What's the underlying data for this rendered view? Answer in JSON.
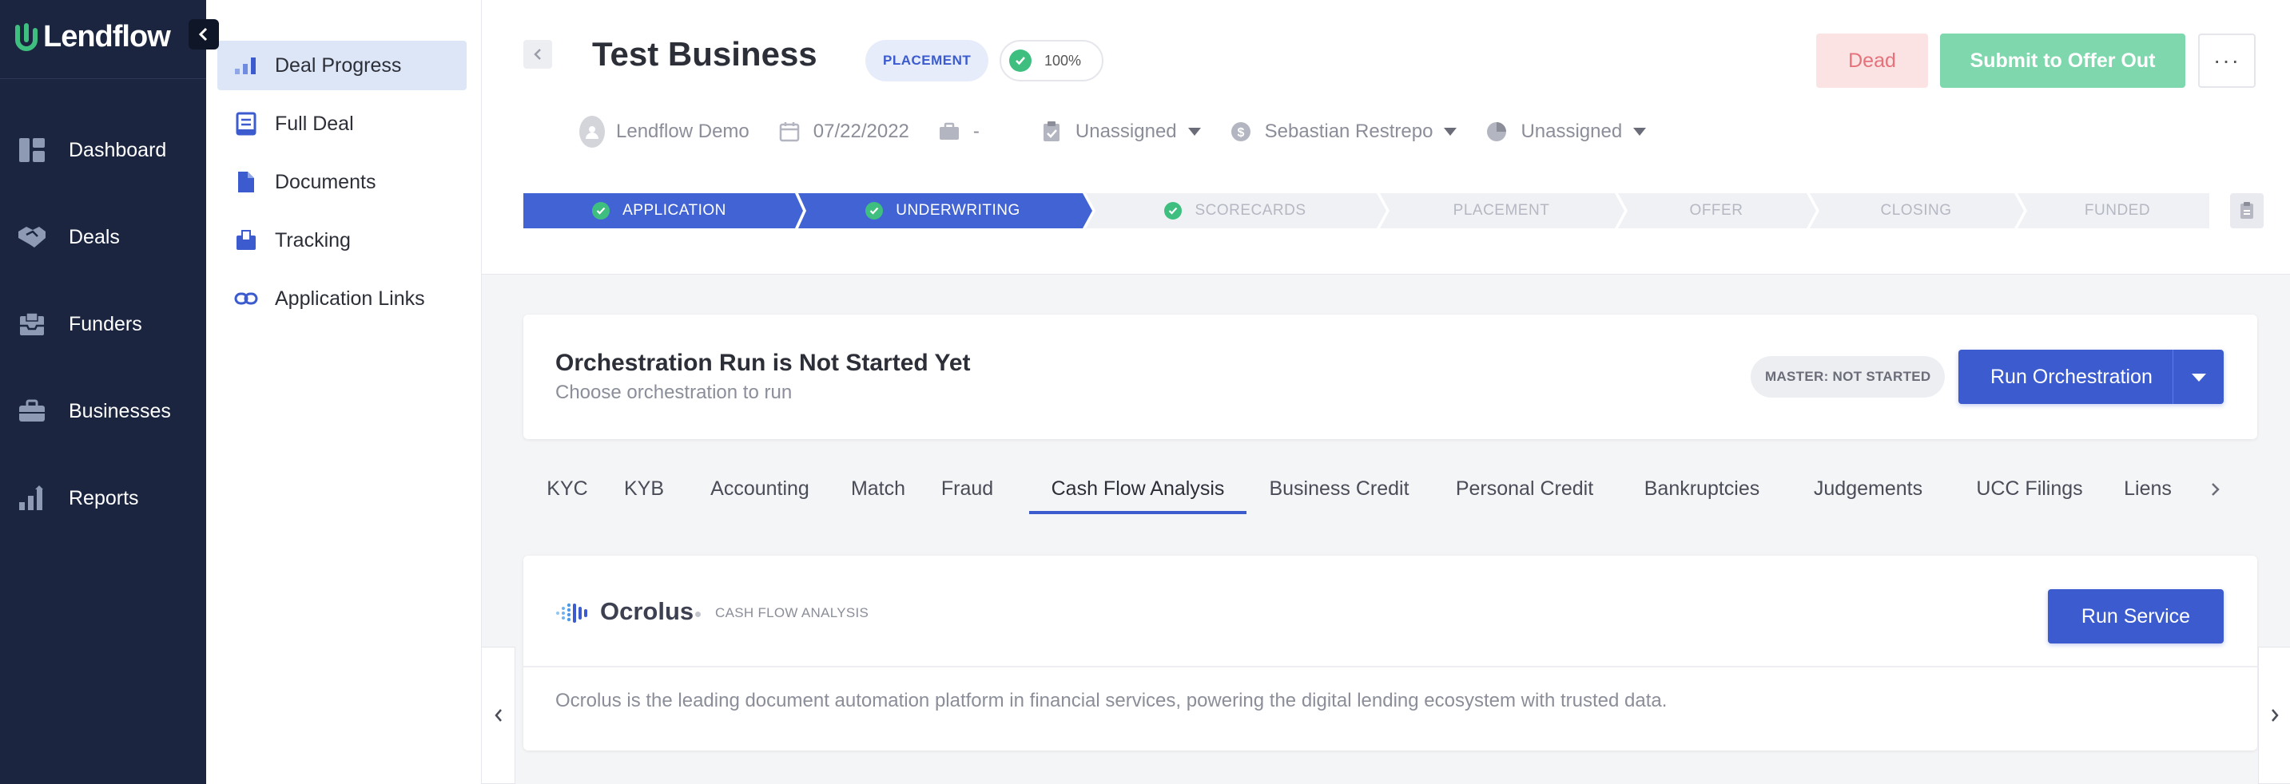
{
  "brand": {
    "name": "Lendflow",
    "accent": "#3b5bcf",
    "nav_bg": "#1b2540",
    "success": "#3fbf7f"
  },
  "leftnav": {
    "items": [
      {
        "label": "Dashboard",
        "icon": "dashboard-icon"
      },
      {
        "label": "Deals",
        "icon": "handshake-icon"
      },
      {
        "label": "Funders",
        "icon": "inbox-icon"
      },
      {
        "label": "Businesses",
        "icon": "briefcase-icon"
      },
      {
        "label": "Reports",
        "icon": "bar-chart-icon"
      }
    ]
  },
  "subnav": {
    "items": [
      {
        "label": "Deal Progress",
        "icon": "bar-chart-icon",
        "active": true
      },
      {
        "label": "Full Deal",
        "icon": "document-icon",
        "active": false
      },
      {
        "label": "Documents",
        "icon": "file-icon",
        "active": false
      },
      {
        "label": "Tracking",
        "icon": "tray-icon",
        "active": false
      },
      {
        "label": "Application Links",
        "icon": "link-icon",
        "active": false
      }
    ]
  },
  "header": {
    "title": "Test Business",
    "stage_badge": "PLACEMENT",
    "progress": "100%",
    "dead_label": "Dead",
    "submit_label": "Submit to Offer Out",
    "more_label": "···",
    "meta": {
      "user": "Lendflow Demo",
      "date": "07/22/2022",
      "briefcase_value": "-",
      "assignee_1": "Unassigned",
      "owner": "Sebastian Restrepo",
      "assignee_2": "Unassigned"
    }
  },
  "stepper": {
    "steps": [
      {
        "label": "APPLICATION",
        "status": "done"
      },
      {
        "label": "UNDERWRITING",
        "status": "done"
      },
      {
        "label": "SCORECARDS",
        "status": "checked"
      },
      {
        "label": "PLACEMENT",
        "status": "pending"
      },
      {
        "label": "OFFER",
        "status": "pending"
      },
      {
        "label": "CLOSING",
        "status": "pending"
      },
      {
        "label": "FUNDED",
        "status": "pending"
      }
    ]
  },
  "orchestration": {
    "title": "Orchestration Run is Not Started Yet",
    "subtitle": "Choose orchestration to run",
    "master_badge": "MASTER: NOT STARTED",
    "run_label": "Run Orchestration"
  },
  "tabs": {
    "items": [
      "KYC",
      "KYB",
      "Accounting",
      "Match",
      "Fraud",
      "Cash Flow Analysis",
      "Business Credit",
      "Personal Credit",
      "Bankruptcies",
      "Judgements",
      "UCC Filings",
      "Liens"
    ],
    "active": "Cash Flow Analysis"
  },
  "service": {
    "name": "Ocrolus",
    "category": "CASH FLOW ANALYSIS",
    "run_label": "Run Service",
    "description": "Ocrolus is the leading document automation platform in financial services, powering the digital lending ecosystem with trusted data."
  }
}
